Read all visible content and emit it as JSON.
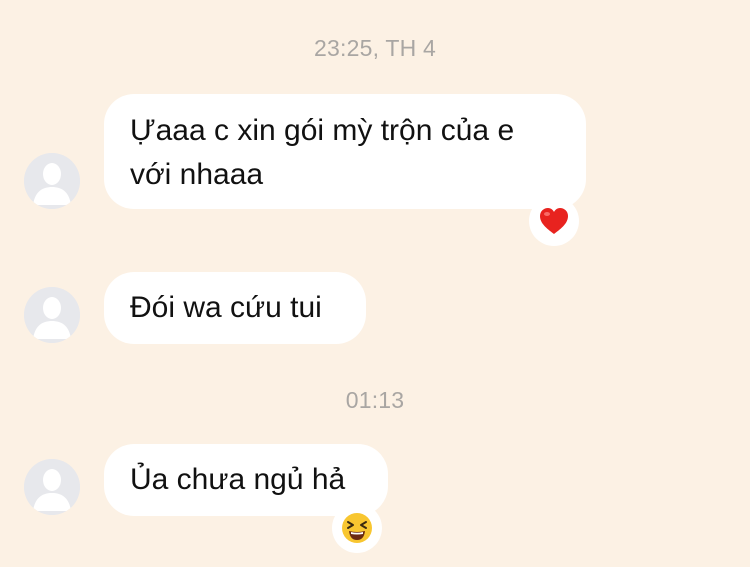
{
  "messages": [
    {
      "timestamp": "23:25, TH 4",
      "text_line1": "Ựaaa c xin gói mỳ trộn của e",
      "text_line2": "với nhaaa",
      "reaction": "heart"
    },
    {
      "text": "Đói wa cứu tui"
    },
    {
      "timestamp": "01:13",
      "text": "Ủa chưa ngủ hả",
      "reaction": "laughing-face"
    }
  ],
  "colors": {
    "background": "#fcf1e4",
    "bubble": "#ffffff",
    "timestamp_text": "#a9a6a3",
    "heart": "#e8231f",
    "emoji_face": "#f8c630"
  }
}
